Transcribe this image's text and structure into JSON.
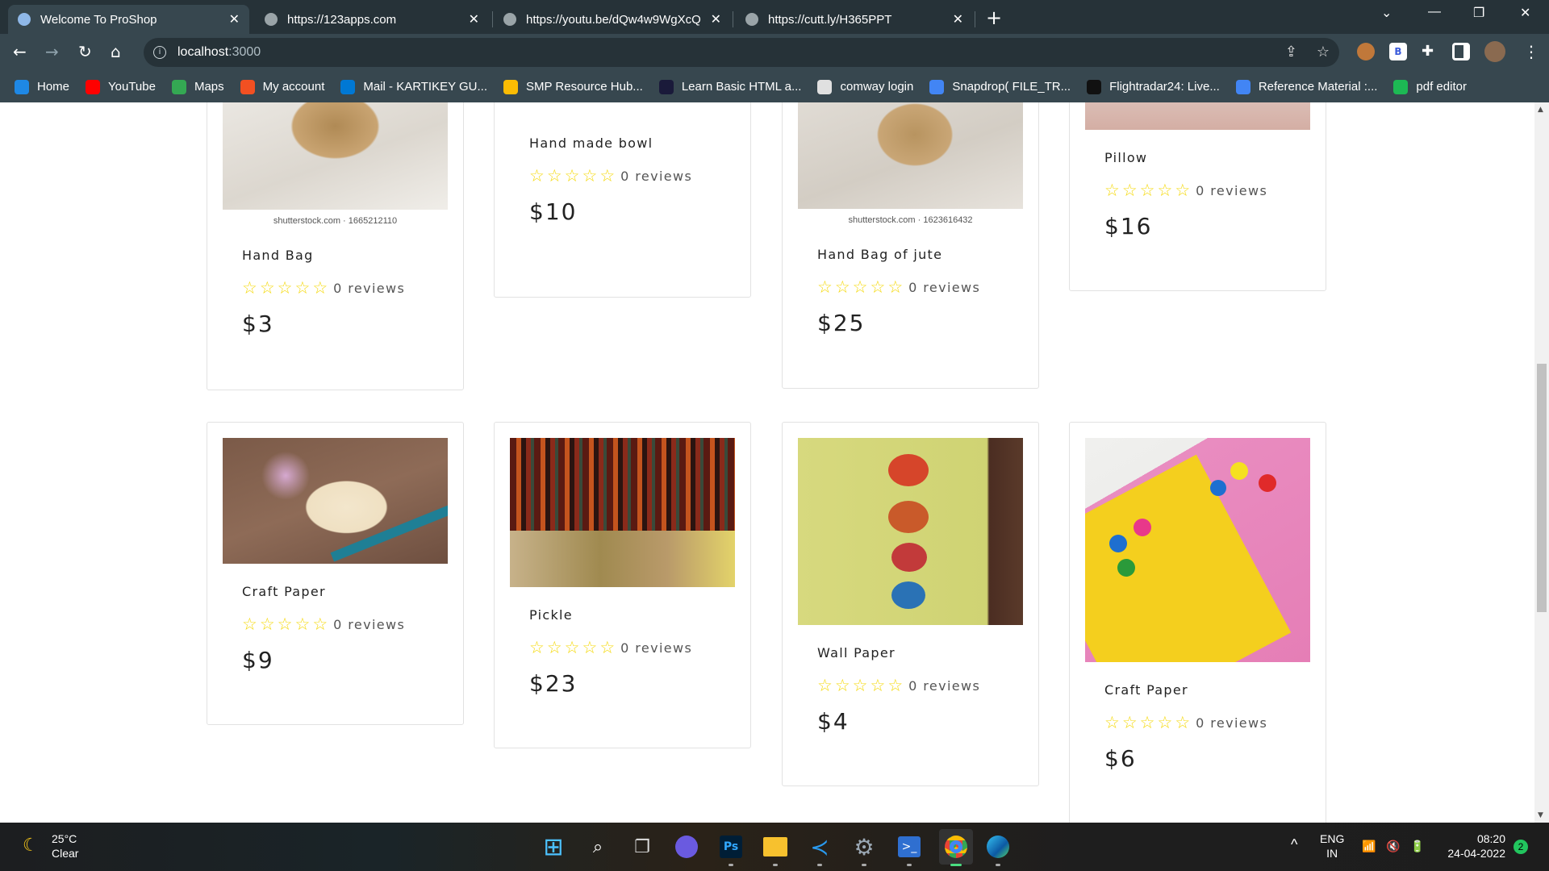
{
  "browser": {
    "tabs": [
      {
        "title": "Welcome To ProShop",
        "active": true
      },
      {
        "title": "https://123apps.com"
      },
      {
        "title": "https://youtu.be/dQw4w9WgXcQ"
      },
      {
        "title": "https://cutt.ly/H365PPT"
      }
    ],
    "url_host": "localhost",
    "url_port": ":3000",
    "bookmarks": [
      {
        "label": "Home",
        "color": "#1e88e5"
      },
      {
        "label": "YouTube",
        "color": "#ff0000"
      },
      {
        "label": "Maps",
        "color": "#34a853"
      },
      {
        "label": "My account",
        "color": "#f25022"
      },
      {
        "label": "Mail - KARTIKEY GU...",
        "color": "#0078d4"
      },
      {
        "label": "SMP Resource Hub...",
        "color": "#fbbc04"
      },
      {
        "label": "Learn Basic HTML a...",
        "color": "#1a1a3a"
      },
      {
        "label": "comway login",
        "color": "#e0e0e0"
      },
      {
        "label": "Snapdrop( FILE_TR...",
        "color": "#4285f4"
      },
      {
        "label": "Flightradar24: Live...",
        "color": "#111111"
      },
      {
        "label": "Reference Material :...",
        "color": "#4285f4"
      },
      {
        "label": "pdf editor",
        "color": "#1db954"
      }
    ]
  },
  "products": [
    {
      "name": "Hand Bag",
      "reviews": "0 reviews",
      "price": "$3",
      "rating": 0,
      "watermark": "shutterstock.com · 1665212110"
    },
    {
      "name": "Hand made bowl",
      "reviews": "0 reviews",
      "price": "$10",
      "rating": 0
    },
    {
      "name": "Hand Bag of jute",
      "reviews": "0 reviews",
      "price": "$25",
      "rating": 0,
      "watermark": "shutterstock.com · 1623616432"
    },
    {
      "name": "Pillow",
      "reviews": "0 reviews",
      "price": "$16",
      "rating": 0
    },
    {
      "name": "Craft Paper",
      "reviews": "0 reviews",
      "price": "$9",
      "rating": 0
    },
    {
      "name": "Pickle",
      "reviews": "0 reviews",
      "price": "$23",
      "rating": 0
    },
    {
      "name": "Wall Paper",
      "reviews": "0 reviews",
      "price": "$4",
      "rating": 0
    },
    {
      "name": "Craft Paper",
      "reviews": "0 reviews",
      "price": "$6",
      "rating": 0
    }
  ],
  "star_color": "#f5d90a",
  "taskbar": {
    "weather_temp": "25°C",
    "weather_desc": "Clear",
    "lang": "ENG",
    "region": "IN",
    "time": "08:20",
    "date": "24-04-2022",
    "notifications": "2"
  }
}
